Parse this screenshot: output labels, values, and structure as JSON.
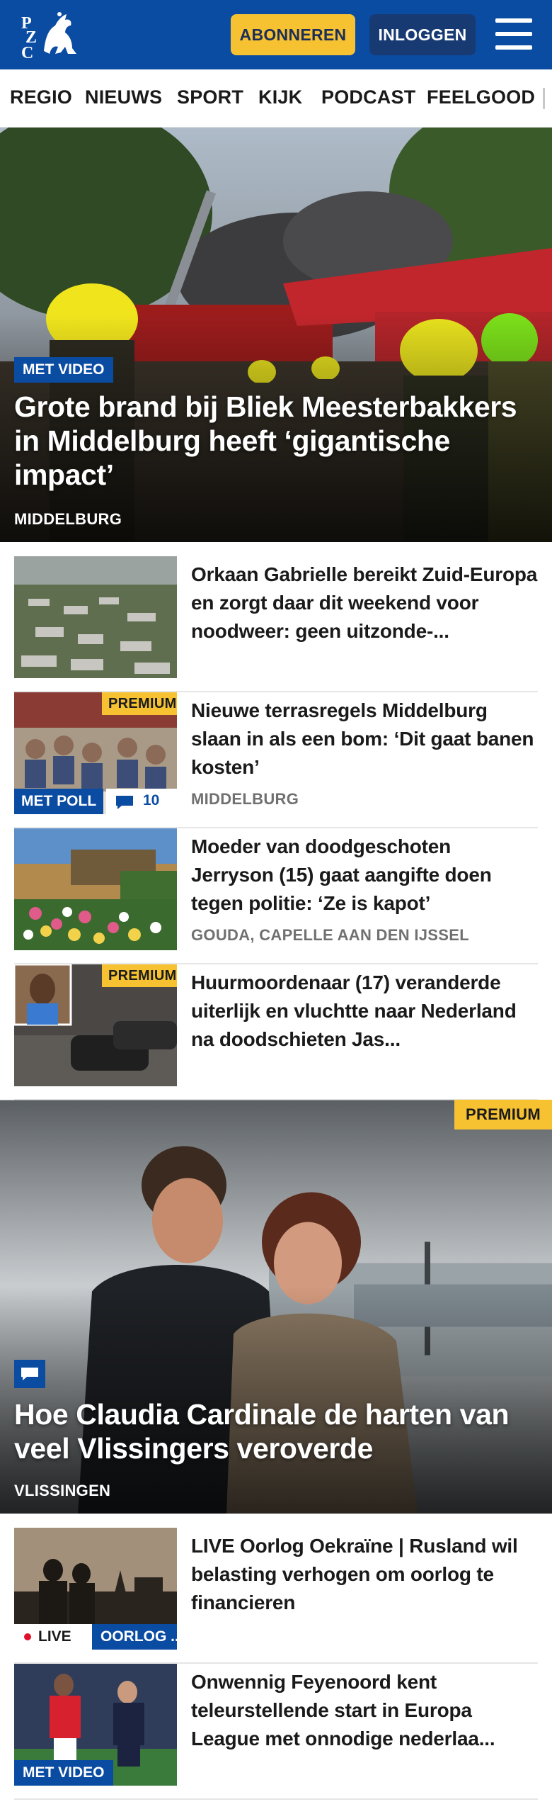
{
  "header": {
    "logo_text": "PZC",
    "subscribe_label": "ABONNEREN",
    "login_label": "INLOGGEN"
  },
  "nav": {
    "items": [
      "REGIO",
      "NIEUWS",
      "SPORT",
      "KIJK",
      "PODCAST",
      "FEELGOOD"
    ]
  },
  "hero": {
    "badge": "MET VIDEO",
    "title": "Grote brand bij Bliek Meesterbakkers in Middelburg heeft ‘gigantische impact’",
    "location": "MIDDELBURG"
  },
  "articles": [
    {
      "title": "Orkaan Gabrielle bereikt Zuid-Europa en zorgt daar dit weekend voor noodweer: geen uitzonde-...",
      "location": ""
    },
    {
      "title": "Nieuwe terrasregels Middelburg slaan in als een bom: ‘Dit gaat banen kosten’",
      "location": "MIDDELBURG",
      "premium_label": "PREMIUM",
      "poll_label": "MET POLL",
      "comment_count": "10"
    },
    {
      "title": "Moeder van doodgeschoten Jerryson (15) gaat aangifte doen tegen politie: ‘Ze is kapot’",
      "location": "GOUDA, CAPELLE AAN DEN IJSSEL"
    },
    {
      "title": "Huurmoordenaar (17) veranderde uiterlijk en vluchtte naar Nederland na doodschieten Jas...",
      "location": "",
      "premium_label": "PREMIUM"
    }
  ],
  "feature": {
    "premium_label": "PREMIUM",
    "title": "Hoe Claudia Cardinale de harten van veel Vlissingers veroverde",
    "location": "VLISSINGEN"
  },
  "bottom_articles": [
    {
      "title": "LIVE Oorlog Oekraïne | Rusland wil belasting verhogen om oorlog te financieren",
      "live_label": "LIVE",
      "tag_label": "OORLOG ..."
    },
    {
      "title": "Onwennig Feyenoord kent teleurstellende start in Europa League met onnodige nederlaa...",
      "badge": "MET VIDEO"
    }
  ],
  "colors": {
    "brand_blue": "#0b4ca3",
    "premium_yellow": "#f6c232",
    "live_red": "#e0102a"
  }
}
